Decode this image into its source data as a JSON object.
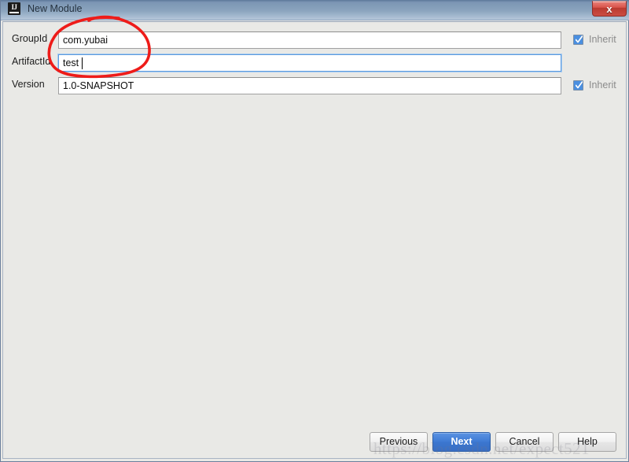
{
  "window": {
    "title": "New Module",
    "app_icon": "intellij-idea-icon",
    "icon_text": "IJ",
    "close_label": "x"
  },
  "form": {
    "fields": [
      {
        "label": "GroupId",
        "value": "com.yubai",
        "focused": false,
        "inherit": {
          "label": "Inherit",
          "checked": true,
          "enabled": false
        }
      },
      {
        "label": "ArtifactId",
        "value": "test",
        "focused": true,
        "inherit": null
      },
      {
        "label": "Version",
        "value": "1.0-SNAPSHOT",
        "focused": false,
        "inherit": {
          "label": "Inherit",
          "checked": true,
          "enabled": false
        }
      }
    ]
  },
  "footer": {
    "buttons": [
      {
        "label": "Previous",
        "primary": false
      },
      {
        "label": "Next",
        "primary": true
      },
      {
        "label": "Cancel",
        "primary": false
      },
      {
        "label": "Help",
        "primary": false
      }
    ]
  },
  "watermark": {
    "text": "https://blog.csdn.net/expect521"
  },
  "annotation": {
    "type": "hand-drawn-ellipse",
    "color": "#ee1c19"
  },
  "colors": {
    "titlebar": "#8ba4be",
    "panel": "#e9e9e6",
    "accent": "#3f7bd4",
    "close": "#d9534a",
    "checkbox": "#4a8fe0",
    "focus_border": "#5c9ade"
  }
}
